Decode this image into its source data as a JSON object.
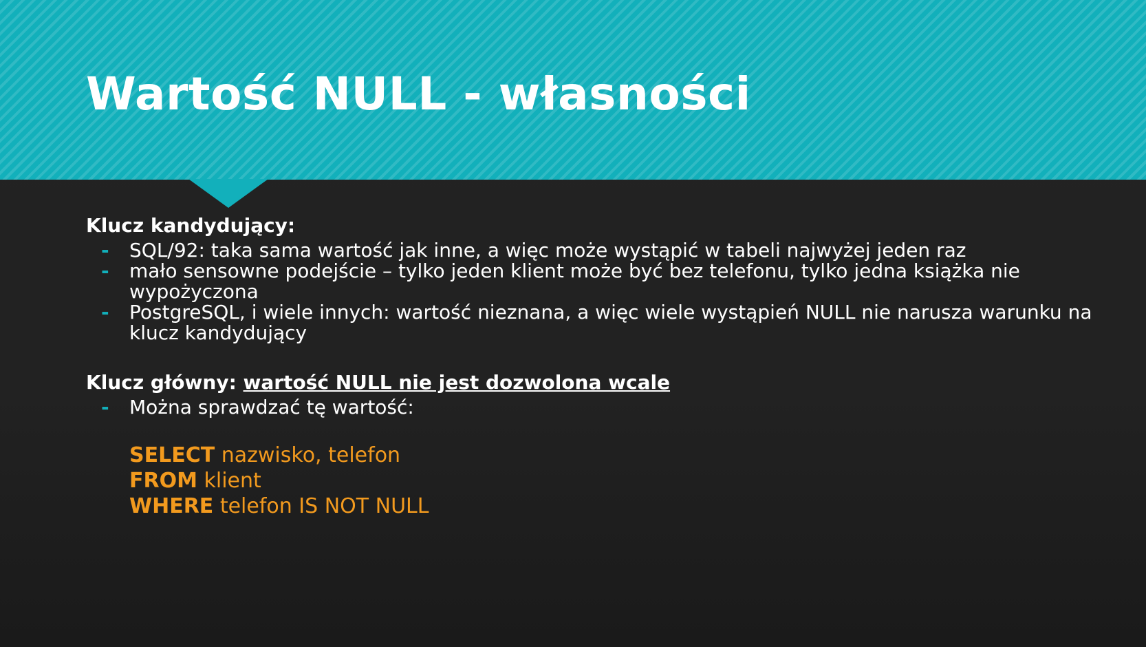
{
  "title": "Wartość NULL - własności",
  "candidate_key": {
    "heading": "Klucz kandydujący:",
    "bullet_marker": "-",
    "items": [
      "SQL/92: taka sama wartość jak inne, a więc może wystąpić w tabeli najwyżej jeden raz",
      "mało sensowne podejście – tylko jeden klient może być bez telefonu, tylko jedna książka nie wypożyczona",
      "PostgreSQL, i wiele innych: wartość nieznana, a więc wiele wystąpień NULL nie narusza warunku na klucz kandydujący"
    ]
  },
  "primary_key": {
    "heading": "Klucz główny:",
    "heading_emphasis": "wartość NULL nie jest dozwolona wcale",
    "bullet_marker": "-",
    "items": [
      "Można sprawdzać tę wartość:"
    ]
  },
  "sql": {
    "select_kw": "SELECT",
    "select_rest": " nazwisko, telefon",
    "from_kw": "FROM",
    "from_rest": " klient",
    "where_kw": "WHERE",
    "where_rest": " telefon IS NOT NULL"
  },
  "colors": {
    "header_band": "#12b0bb",
    "background": "#222222",
    "bullet_dash": "#12b0bb",
    "sql_text": "#f29a1e",
    "text": "#ffffff"
  }
}
